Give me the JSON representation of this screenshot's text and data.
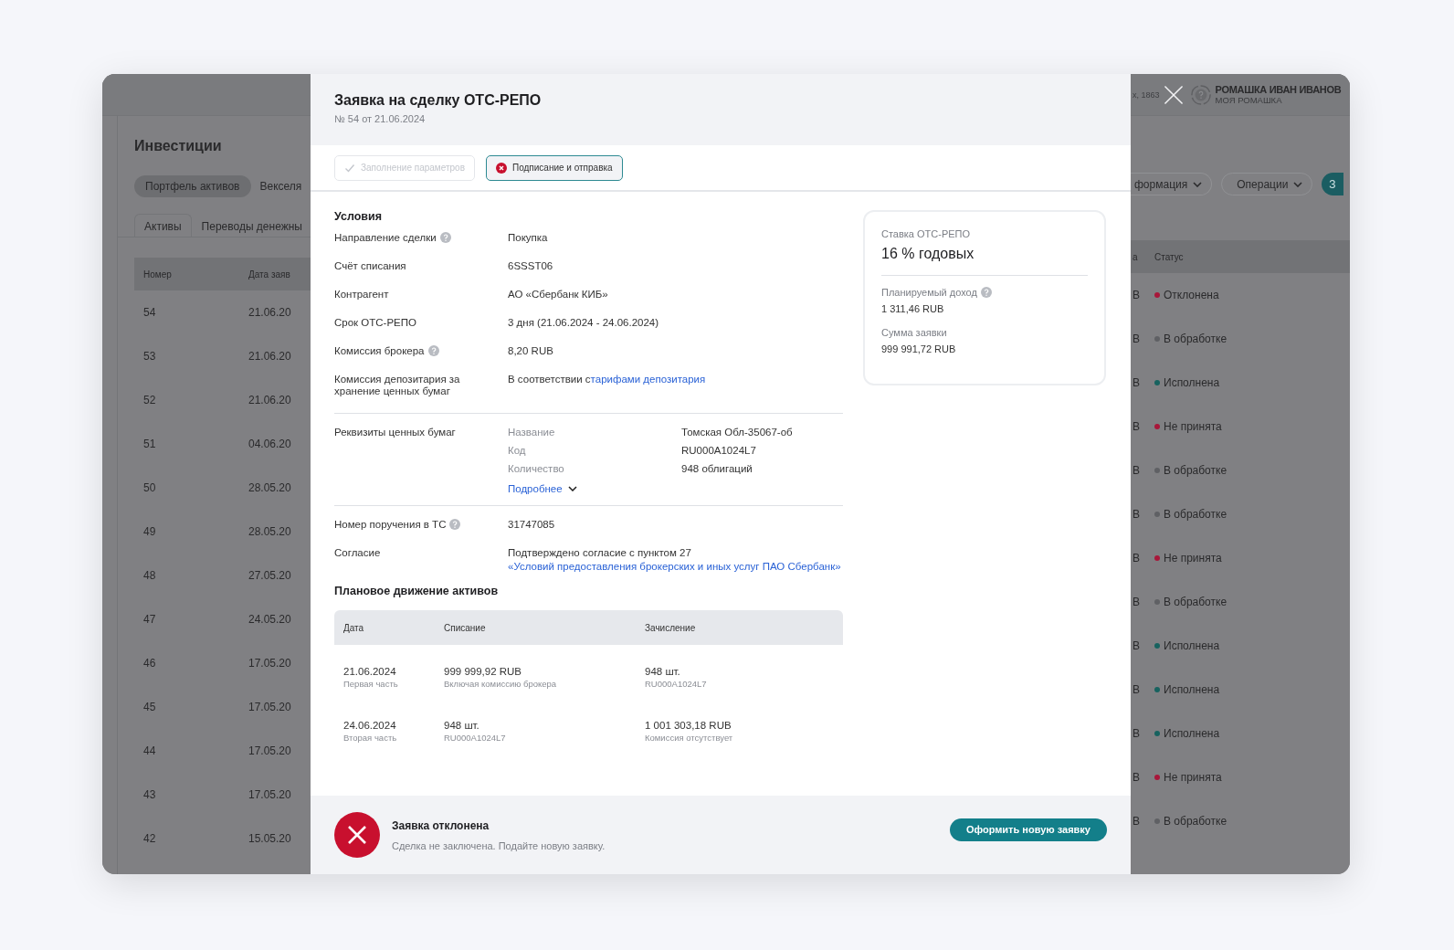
{
  "background": {
    "page_title": "Инвестиции",
    "chips": [
      {
        "label": "Портфель активов",
        "selected": true
      },
      {
        "label": "Векселя",
        "selected": false
      }
    ],
    "tabs": [
      {
        "label": "Активы",
        "selected": true
      },
      {
        "label": "Переводы денежны",
        "selected": false
      }
    ],
    "left_columns": [
      "Номер",
      "Дата заяв"
    ],
    "menus": [
      {
        "label": "формация"
      },
      {
        "label": "Операции"
      }
    ],
    "action_button": "З",
    "right_columns": [
      "а",
      "Статус"
    ],
    "rows": [
      {
        "number": "54",
        "date": "21.06.20",
        "column_3": "B",
        "status": "Отклонена",
        "color": "#a8173a"
      },
      {
        "number": "53",
        "date": "21.06.20",
        "column_3": "B",
        "status": "В обработке",
        "color": "#5f6064"
      },
      {
        "number": "52",
        "date": "21.06.20",
        "column_3": "B",
        "status": "Исполнена",
        "color": "#17625f"
      },
      {
        "number": "51",
        "date": "04.06.20",
        "column_3": "B",
        "status": "Не принята",
        "color": "#a8173a"
      },
      {
        "number": "50",
        "date": "28.05.20",
        "column_3": "B",
        "status": "В обработке",
        "color": "#5f6064"
      },
      {
        "number": "49",
        "date": "28.05.20",
        "column_3": "B",
        "status": "В обработке",
        "color": "#5f6064"
      },
      {
        "number": "48",
        "date": "27.05.20",
        "column_3": "B",
        "status": "Не принята",
        "color": "#a8173a"
      },
      {
        "number": "47",
        "date": "24.05.20",
        "column_3": "B",
        "status": "В обработке",
        "color": "#5f6064"
      },
      {
        "number": "46",
        "date": "17.05.20",
        "column_3": "B",
        "status": "Исполнена",
        "color": "#17625f"
      },
      {
        "number": "45",
        "date": "17.05.20",
        "column_3": "B",
        "status": "Исполнена",
        "color": "#17625f"
      },
      {
        "number": "44",
        "date": "17.05.20",
        "column_3": "B",
        "status": "Исполнена",
        "color": "#17625f"
      },
      {
        "number": "43",
        "date": "17.05.20",
        "column_3": "B",
        "status": "Не принята",
        "color": "#a8173a"
      },
      {
        "number": "42",
        "date": "15.05.20",
        "column_3": "B",
        "status": "В обработке",
        "color": "#5f6064"
      }
    ]
  },
  "user": {
    "info": "х, 1863",
    "name": "РОМАШКА ИВАН ИВАНОВ",
    "company": "МОЯ РОМАШКА"
  },
  "modal": {
    "title": "Заявка на сделку ОТС-РЕПО",
    "subtitle": "№ 54 от 21.06.2024",
    "steps": [
      {
        "label": "Заполнение параметров",
        "kind": "done",
        "selected": false
      },
      {
        "label": "Подписание и отправка",
        "kind": "error",
        "selected": true
      }
    ],
    "conditions_title": "Условия",
    "conditions": [
      {
        "label": "Направление сделки",
        "hint": true,
        "value": "Покупка"
      },
      {
        "label": "Счёт списания",
        "hint": false,
        "value": "6SSST06"
      },
      {
        "label": "Контрагент",
        "hint": false,
        "value": "АО «Сбербанк КИБ»"
      },
      {
        "label": "Срок ОТС-РЕПО",
        "hint": false,
        "value": "3 дня (21.06.2024 - 24.06.2024)"
      },
      {
        "label": "Комиссия брокера",
        "hint": true,
        "value": "8,20 RUB"
      },
      {
        "label": "Комиссия депозитария за хранение ценных бумаг",
        "hint": false,
        "value": "В соответствии с",
        "link": "тарифами депозитария"
      }
    ],
    "securities": {
      "label": "Реквизиты ценных бумаг",
      "fields": [
        {
          "name": "Название",
          "value": "Томская Обл-35067-об"
        },
        {
          "name": "Код",
          "value": "RU000A1024L7"
        },
        {
          "name": "Количество",
          "value": "948 облигаций"
        }
      ],
      "more": "Подробнее"
    },
    "order": {
      "label": "Номер поручения в ТС",
      "hint": true,
      "value": "31747085"
    },
    "consent": {
      "label": "Согласие",
      "value": "Подтверждено согласие с пунктом 27",
      "link": "«Условий предоставления брокерских и иных услуг ПАО Сбербанк»"
    },
    "movement": {
      "title": "Плановое движение активов",
      "columns": [
        "Дата",
        "Списание",
        "Зачисление"
      ],
      "rows": [
        [
          {
            "main": "21.06.2024",
            "sub": "Первая часть"
          },
          {
            "main": "999 999,92 RUB",
            "sub": "Включая комиссию брокера"
          },
          {
            "main": "948 шт.",
            "sub": "RU000A1024L7"
          }
        ],
        [
          {
            "main": "24.06.2024",
            "sub": "Вторая часть"
          },
          {
            "main": "948 шт.",
            "sub": "RU000A1024L7"
          },
          {
            "main": "1 001 303,18 RUB",
            "sub": "Комиссия отсутствует"
          }
        ]
      ]
    },
    "card": {
      "rate_label": "Ставка ОТС-РЕПО",
      "rate_value": "16 % годовых",
      "items": [
        {
          "label": "Планируемый доход",
          "hint": true,
          "value": "1 311,46 RUB"
        },
        {
          "label": "Сумма заявки",
          "hint": false,
          "value": "999 991,72 RUB"
        }
      ]
    },
    "footer": {
      "kind": "rejected",
      "title": "Заявка отклонена",
      "text": "Сделка не заключена. Подайте новую заявку.",
      "button": "Оформить новую заявку"
    }
  }
}
